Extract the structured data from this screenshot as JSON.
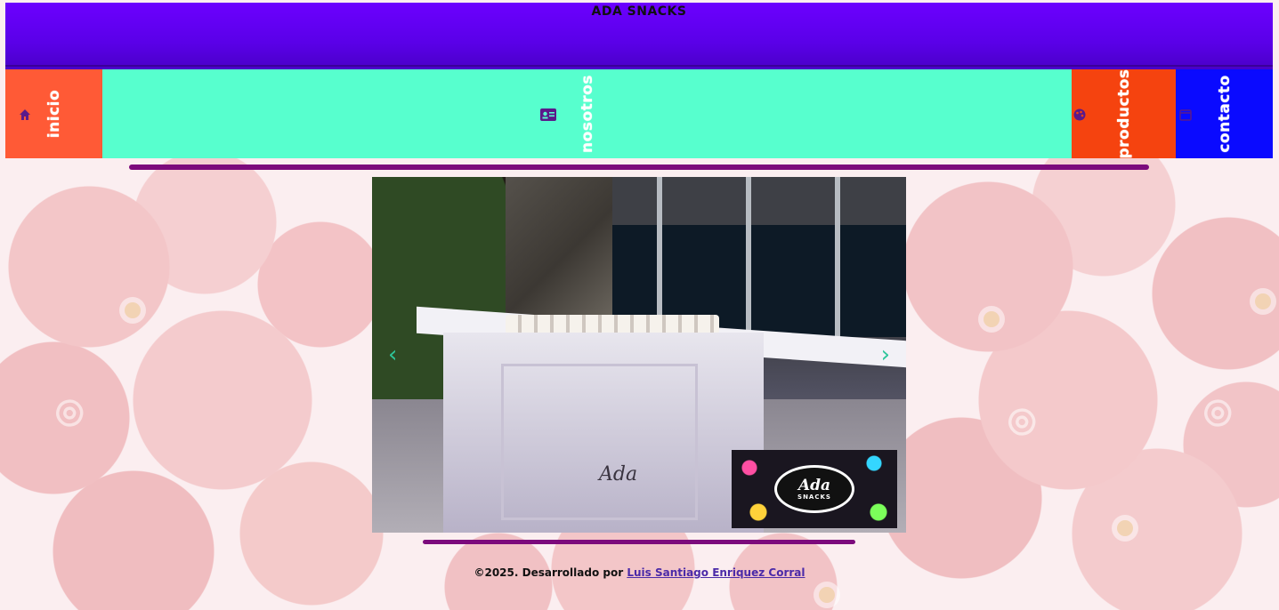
{
  "header": {
    "brand": "ADA SNACKS",
    "background": "#6600ff"
  },
  "nav": {
    "items": [
      {
        "label": "inicio",
        "icon": "home-icon",
        "color": "#ff5a36"
      },
      {
        "label": "nosotros",
        "icon": "id-card-icon",
        "color": "#57ffce"
      },
      {
        "label": "productos",
        "icon": "palette-icon",
        "color": "#f5430f"
      },
      {
        "label": "contacto",
        "icon": "calendar-icon",
        "color": "#0a0aff"
      }
    ]
  },
  "carousel": {
    "prev_label": "‹",
    "next_label": "›",
    "logo_text": "Ada",
    "logo_subtext": "SNACKS",
    "table_script": "Ada"
  },
  "footer": {
    "text": "©2025. Desarrollado por",
    "author_link": "Luis Santiago Enriquez Corral"
  },
  "colors": {
    "divider": "#7c0a7c",
    "carousel_control": "#2ec59a"
  }
}
